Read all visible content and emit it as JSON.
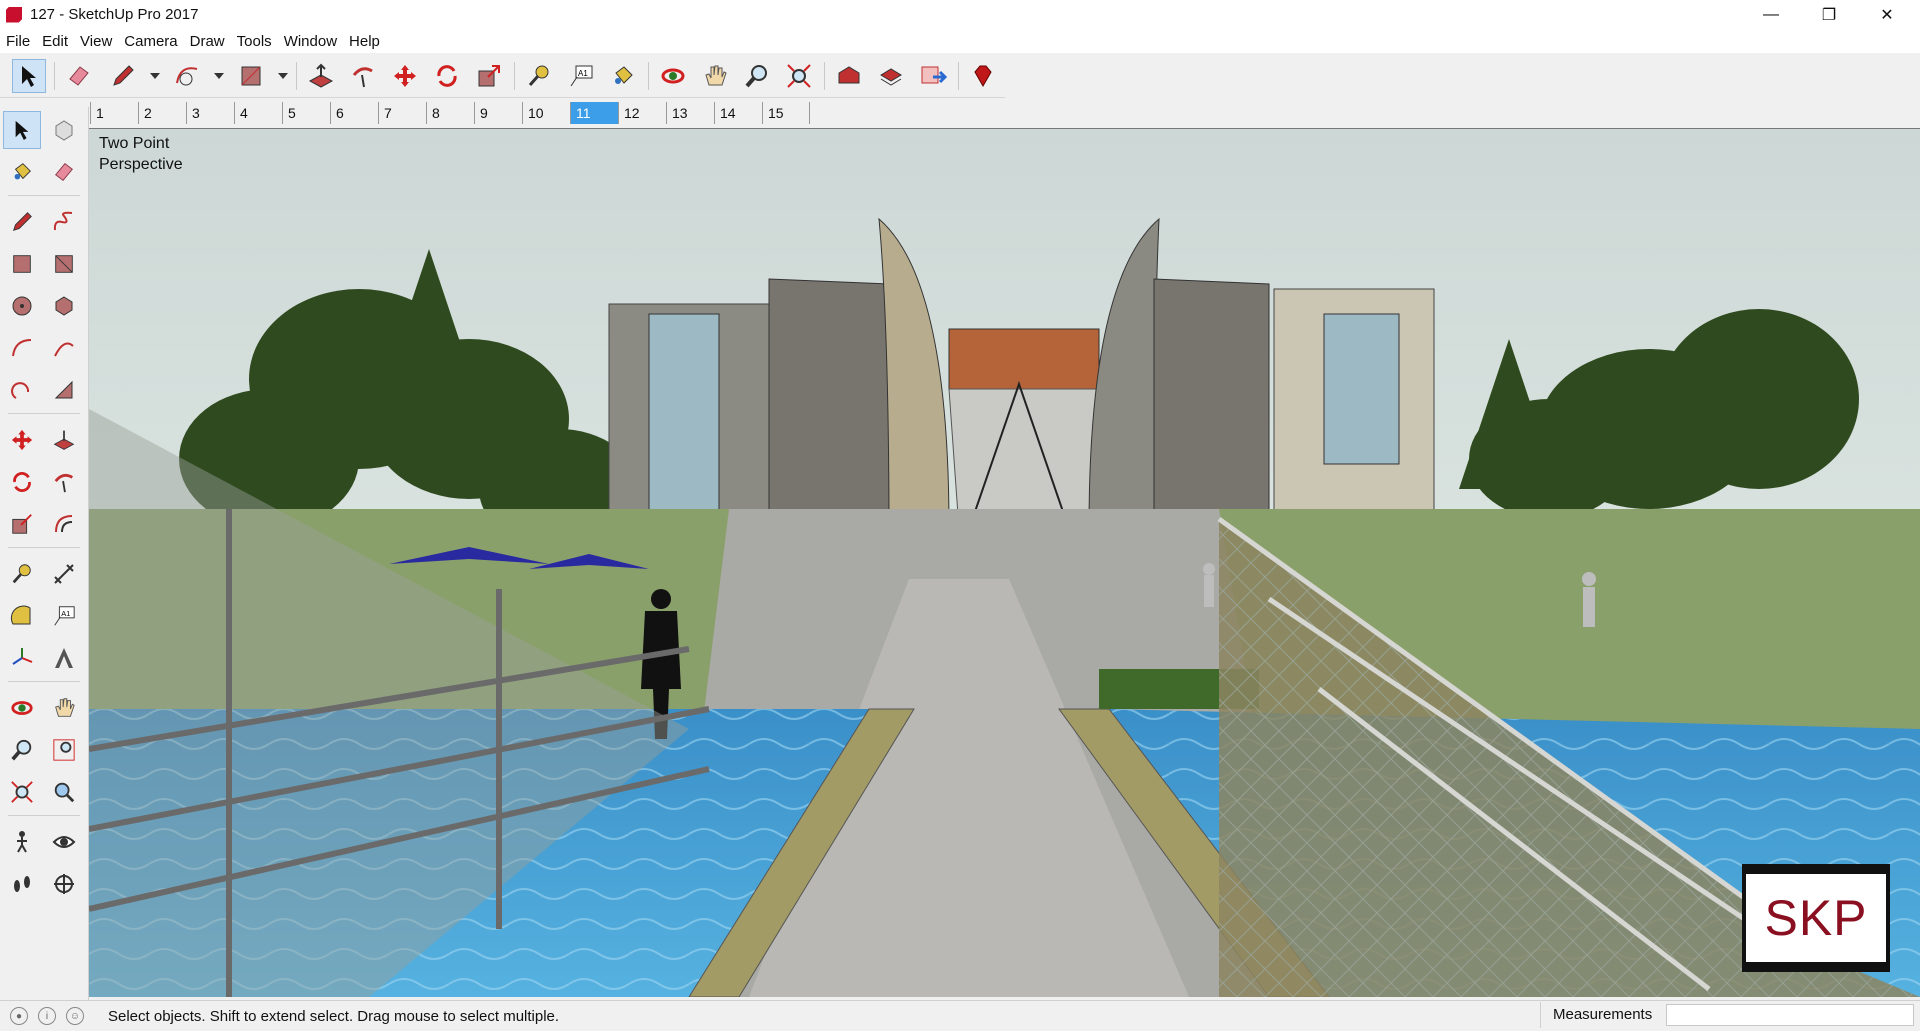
{
  "window": {
    "title": "127 - SketchUp Pro 2017",
    "minimize": "—",
    "restore": "❐",
    "close": "✕"
  },
  "menu": [
    "File",
    "Edit",
    "View",
    "Camera",
    "Draw",
    "Tools",
    "Window",
    "Help"
  ],
  "scene_tabs": {
    "items": [
      "1",
      "2",
      "3",
      "4",
      "5",
      "6",
      "7",
      "8",
      "9",
      "10",
      "11",
      "12",
      "13",
      "14",
      "15"
    ],
    "active": "11"
  },
  "viewport": {
    "view_label_line1": "Two Point",
    "view_label_line2": "Perspective",
    "watermark": "SKP"
  },
  "statusbar": {
    "hint": "Select objects. Shift to extend select. Drag mouse to select multiple.",
    "measurements_label": "Measurements",
    "measurements_value": ""
  },
  "colors": {
    "active_tab": "#3c9de8",
    "sky": "#d8e4e4",
    "water": "#3f9ad2",
    "path": "#a8a8a8",
    "trees": "#2f4a1f",
    "brand_red": "#c8102e"
  },
  "toolbar_icons": [
    "select-icon",
    "eraser-icon",
    "pencil-icon",
    "arc-icon",
    "rectangle-icon",
    "push-pull-icon",
    "follow-me-icon",
    "move-icon",
    "rotate-icon",
    "scale-icon",
    "tape-measure-icon",
    "text-icon",
    "paint-bucket-icon",
    "orbit-icon",
    "pan-icon",
    "zoom-icon",
    "zoom-extents-icon",
    "warehouse-icon",
    "extension-warehouse-icon",
    "send-to-layout-icon",
    "ruby-icon"
  ]
}
